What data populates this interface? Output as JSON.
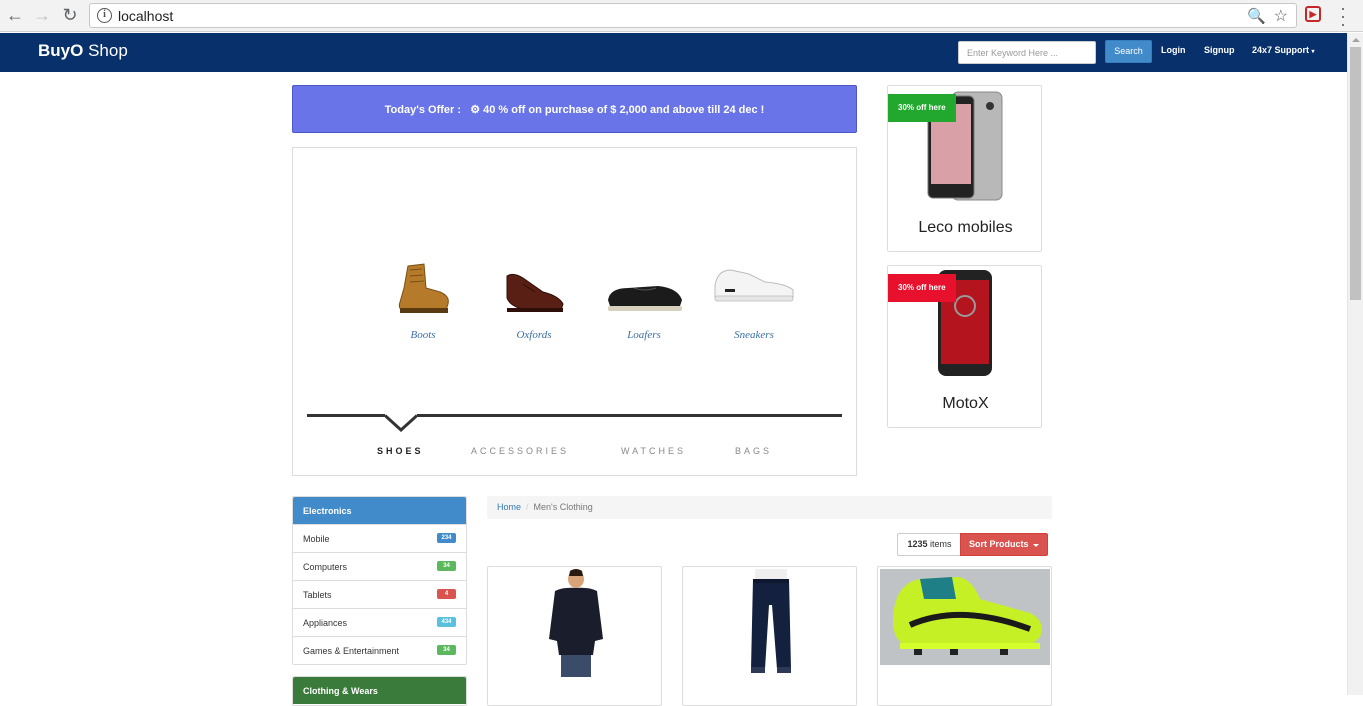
{
  "browser": {
    "url": "localhost"
  },
  "navbar": {
    "brand_bold": "BuyO",
    "brand_rest": " Shop",
    "search_placeholder": "Enter Keyword Here ...",
    "search_label": "Search",
    "login_label": "Login",
    "signup_label": "Signup",
    "support_label": "24x7 Support"
  },
  "offer": {
    "label": "Today's Offer :",
    "text": "40 % off on purchase of $ 2,000 and above till 24 dec !"
  },
  "carousel": {
    "items": [
      {
        "label": "Boots"
      },
      {
        "label": "Oxfords"
      },
      {
        "label": "Loafers"
      },
      {
        "label": "Sneakers"
      }
    ],
    "tabs": [
      {
        "label": "SHOES",
        "active": true
      },
      {
        "label": "ACCESSORIES",
        "active": false
      },
      {
        "label": "WATCHES",
        "active": false
      },
      {
        "label": "BAGS",
        "active": false
      }
    ]
  },
  "ads": [
    {
      "badge": "30% off here",
      "badge_color": "#22a82e",
      "title": "Leco mobiles"
    },
    {
      "badge": "30% off here",
      "badge_color": "#e8112d",
      "title": "MotoX"
    }
  ],
  "sidebar": {
    "electronics": {
      "title": "Electronics",
      "color": "#428bca",
      "items": [
        {
          "label": "Mobile",
          "count": "234",
          "color": "#428bca"
        },
        {
          "label": "Computers",
          "count": "34",
          "color": "#5cb85c"
        },
        {
          "label": "Tablets",
          "count": "4",
          "color": "#d9534f"
        },
        {
          "label": "Appliances",
          "count": "434",
          "color": "#5bc0de"
        },
        {
          "label": "Games & Entertainment",
          "count": "34",
          "color": "#5cb85c"
        }
      ]
    },
    "clothing": {
      "title": "Clothing & Wears",
      "color": "#3a7a3a"
    }
  },
  "breadcrumb": {
    "home": "Home",
    "current": "Men's Clothing"
  },
  "sort": {
    "count_num": "1235",
    "count_unit": " items",
    "sort_label": "Sort Products"
  }
}
